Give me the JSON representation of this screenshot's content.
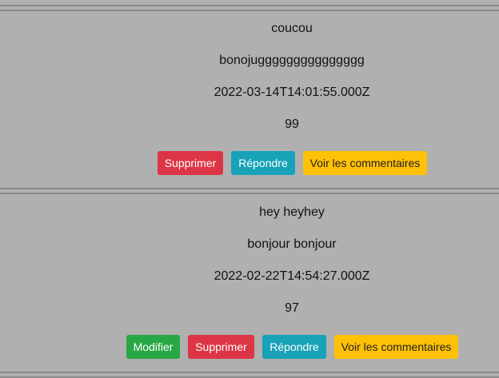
{
  "posts": [
    {
      "title": "coucou",
      "content": "bonojuggggggggggggggg",
      "date": "2022-03-14T14:01:55.000Z",
      "count": "99",
      "actions": {
        "delete_label": "Supprimer",
        "reply_label": "Répondre",
        "comments_label": "Voir les commentaires"
      }
    },
    {
      "title": "hey heyhey",
      "content": "bonjour bonjour",
      "date": "2022-02-22T14:54:27.000Z",
      "count": "97",
      "actions": {
        "edit_label": "Modifier",
        "delete_label": "Supprimer",
        "reply_label": "Répondre",
        "comments_label": "Voir les commentaires"
      }
    }
  ],
  "colors": {
    "background": "#b0b0b0",
    "divider": "#8a8a8a",
    "edit": "#28a745",
    "delete": "#dc3545",
    "reply": "#17a2b8",
    "comments": "#ffc107"
  }
}
